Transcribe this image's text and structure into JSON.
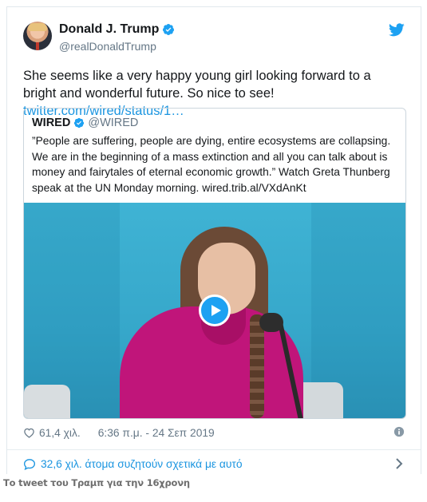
{
  "tweet": {
    "display_name": "Donald J. Trump",
    "handle": "@realDonaldTrump",
    "text": "She seems like a very happy young girl looking forward to a bright and wonderful future. So nice to see! ",
    "link": "twitter.com/wired/status/1…",
    "likes": "61,4 χιλ.",
    "timestamp": "6:36 π.μ. - 24 Σεπ 2019",
    "conversation": "32,6 χιλ. άτομα συζητούν σχετικά με αυτό"
  },
  "quote": {
    "display_name": "WIRED",
    "handle": "@WIRED",
    "text": "”People are suffering, people are dying, entire ecosystems are collapsing. We are in the beginning of a mass extinction and all you can talk about is money and fairytales of eternal economic growth.” Watch Greta Thunberg speak at the UN Monday morning. wired.trib.al/VXdAnKt"
  },
  "caption": "Το tweet του Τραμπ για την 16χρονη",
  "icons": {
    "verified": "verified-badge-icon",
    "bird": "twitter-bird-icon",
    "heart": "heart-icon",
    "info": "info-icon",
    "reply": "speech-bubble-icon",
    "chevron": "chevron-right-icon",
    "play": "play-icon"
  },
  "colors": {
    "accent": "#1da1f2",
    "link": "#1b95e0",
    "muted": "#657786",
    "text": "#14171a"
  }
}
